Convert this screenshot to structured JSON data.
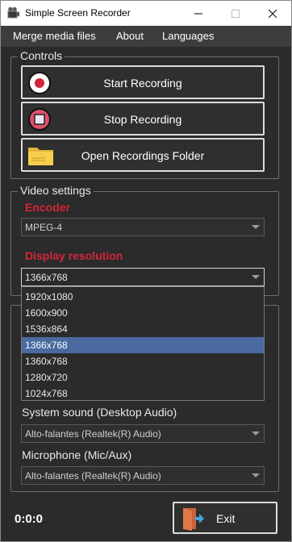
{
  "window": {
    "title": "Simple Screen Recorder"
  },
  "menu": {
    "items": [
      "Merge media files",
      "About",
      "Languages"
    ]
  },
  "controls": {
    "group_title": "Controls",
    "start_label": "Start Recording",
    "stop_label": "Stop Recording",
    "open_folder_label": "Open Recordings Folder"
  },
  "video": {
    "group_title": "Video settings",
    "encoder_label": "Encoder",
    "encoder_value": "MPEG-4",
    "resolution_label": "Display resolution",
    "resolution_value": "1366x768",
    "resolution_options": [
      "1920x1080",
      "1600x900",
      "1536x864",
      "1366x768",
      "1360x768",
      "1280x720",
      "1024x768"
    ],
    "selected_option_index": 3
  },
  "audio": {
    "system_label": "System sound (Desktop Audio)",
    "system_value": "Alto-falantes (Realtek(R) Audio)",
    "mic_label": "Microphone (Mic/Aux)",
    "mic_value": "Alto-falantes (Realtek(R) Audio)"
  },
  "status": {
    "timer": "0:0:0",
    "exit_label": "Exit"
  },
  "colors": {
    "accent_red": "#d3263a",
    "selection_blue": "#4a6aa0",
    "background": "#2b2b2b"
  }
}
